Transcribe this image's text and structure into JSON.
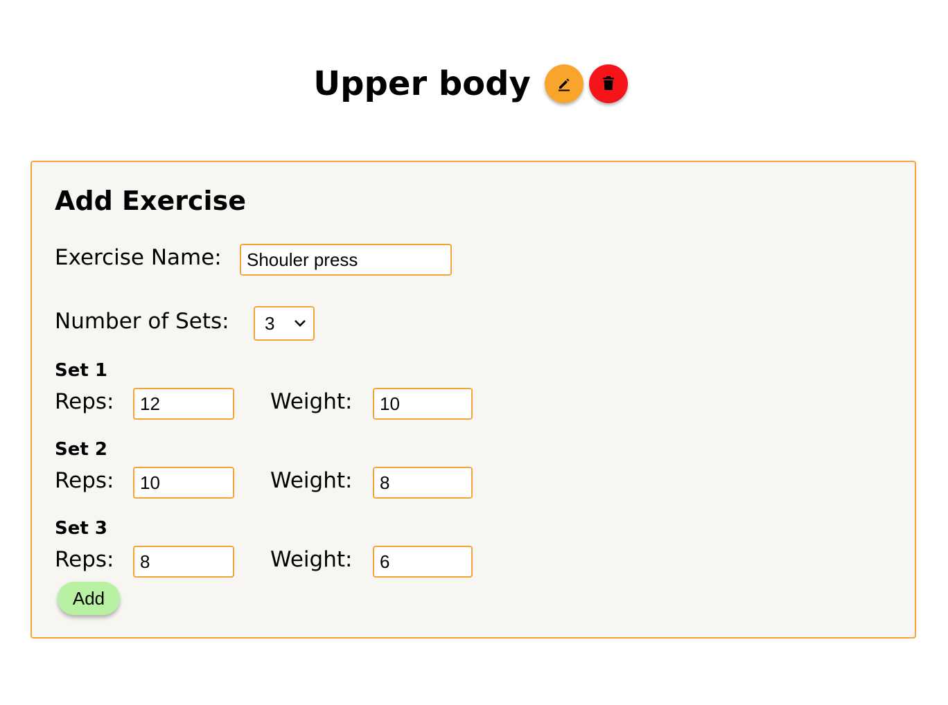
{
  "header": {
    "title": "Upper body",
    "edit_icon": "edit-pencil-icon",
    "delete_icon": "trash-icon",
    "edit_color": "#f9a42b",
    "delete_color": "#f5141a"
  },
  "form": {
    "title": "Add Exercise",
    "exercise_name_label": "Exercise Name:",
    "exercise_name_value": "Shouler press",
    "sets_label": "Number of Sets:",
    "sets_value": "3",
    "sets": [
      {
        "label": "Set 1",
        "reps_label": "Reps:",
        "reps": "12",
        "weight_label": "Weight:",
        "weight": "10"
      },
      {
        "label": "Set 2",
        "reps_label": "Reps:",
        "reps": "10",
        "weight_label": "Weight:",
        "weight": "8"
      },
      {
        "label": "Set 3",
        "reps_label": "Reps:",
        "reps": "8",
        "weight_label": "Weight:",
        "weight": "6"
      }
    ],
    "add_label": "Add",
    "accent_color": "#f5a43a",
    "add_color": "#b9f1a3"
  }
}
